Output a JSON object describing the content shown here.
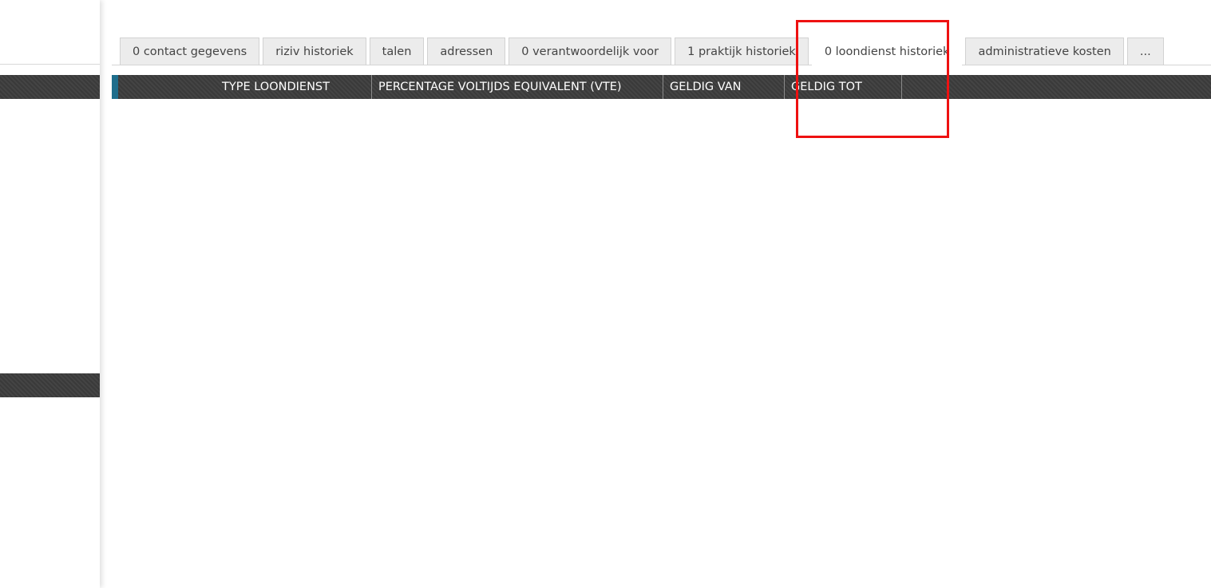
{
  "tabs": [
    {
      "label": "0 contact gegevens",
      "active": false
    },
    {
      "label": "riziv historiek",
      "active": false
    },
    {
      "label": "talen",
      "active": false
    },
    {
      "label": "adressen",
      "active": false
    },
    {
      "label": "0 verantwoordelijk voor",
      "active": false
    },
    {
      "label": "1 praktijk historiek",
      "active": false
    },
    {
      "label": "0 loondienst historiek",
      "active": true
    },
    {
      "label": "administratieve kosten",
      "active": false
    },
    {
      "label": "...",
      "active": false
    }
  ],
  "grid": {
    "columns": [
      "TYPE LOONDIENST",
      "PERCENTAGE VOLTIJDS EQUIVALENT (VTE)",
      "GELDIG VAN",
      "GELDIG TOT"
    ],
    "rows": []
  },
  "colors": {
    "header_background": "#3d3d3d",
    "accent": "#1f6e8c",
    "highlight": "#ee1111",
    "tab_background": "#ececec"
  }
}
